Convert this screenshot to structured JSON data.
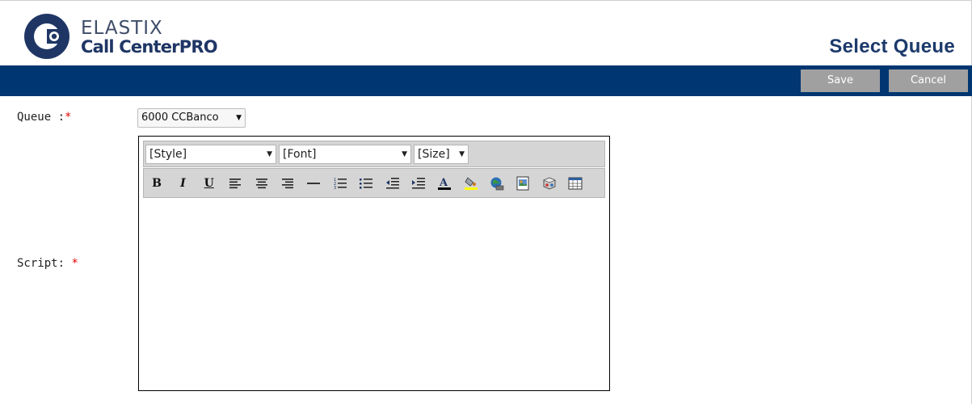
{
  "header": {
    "brand": "ELASTIX",
    "product": "Call Center",
    "product_suffix": "PRO",
    "page_title": "Select Queue"
  },
  "toolbar": {
    "save_label": "Save",
    "cancel_label": "Cancel"
  },
  "form": {
    "queue_label": "Queue :",
    "queue_required": "*",
    "queue_value": "6000 CCBanco",
    "script_label": "Script:",
    "script_required": "*"
  },
  "editor": {
    "style_value": "[Style]",
    "font_value": "[Font]",
    "size_value": "[Size]",
    "tools": [
      {
        "name": "bold-icon",
        "glyph": "B"
      },
      {
        "name": "italic-icon",
        "glyph": "I"
      },
      {
        "name": "underline-icon",
        "glyph": "U"
      },
      {
        "name": "align-left-icon",
        "glyph": ""
      },
      {
        "name": "align-center-icon",
        "glyph": ""
      },
      {
        "name": "align-right-icon",
        "glyph": ""
      },
      {
        "name": "horizontal-rule-icon",
        "glyph": ""
      },
      {
        "name": "ordered-list-icon",
        "glyph": ""
      },
      {
        "name": "unordered-list-icon",
        "glyph": ""
      },
      {
        "name": "outdent-icon",
        "glyph": ""
      },
      {
        "name": "indent-icon",
        "glyph": ""
      },
      {
        "name": "font-color-icon",
        "glyph": "A"
      },
      {
        "name": "highlight-icon",
        "glyph": ""
      },
      {
        "name": "insert-link-icon",
        "glyph": ""
      },
      {
        "name": "insert-image-icon",
        "glyph": ""
      },
      {
        "name": "insert-object-icon",
        "glyph": ""
      },
      {
        "name": "insert-table-icon",
        "glyph": ""
      }
    ],
    "content": ""
  },
  "colors": {
    "bar": "#003671",
    "title": "#1c3a6b",
    "button": "#a0a0a0",
    "required": "#e00000"
  }
}
